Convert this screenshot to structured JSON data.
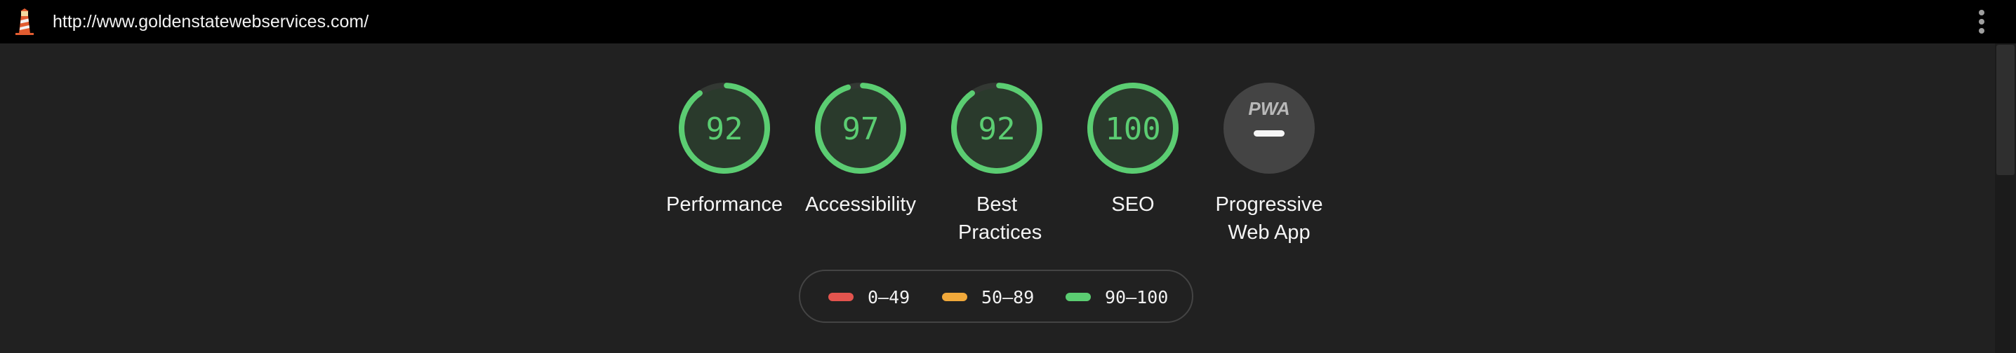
{
  "header": {
    "url": "http://www.goldenstatewebservices.com/",
    "logo_icon": "lighthouse-icon",
    "menu_icon": "vertical-dots-icon"
  },
  "gauges": [
    {
      "score": "92",
      "label": "Performance",
      "color": "#5bcd72",
      "fraction": 0.92
    },
    {
      "score": "97",
      "label": "Accessibility",
      "color": "#5bcd72",
      "fraction": 0.97
    },
    {
      "score": "92",
      "label": "Best Practices",
      "color": "#5bcd72",
      "fraction": 0.92
    },
    {
      "score": "100",
      "label": "SEO",
      "color": "#5bcd72",
      "fraction": 1.0
    }
  ],
  "pwa": {
    "badge_text": "PWA",
    "label": "Progressive Web App",
    "icon": "pwa-dash-icon"
  },
  "legend": [
    {
      "range": "0–49",
      "color": "#e3544e"
    },
    {
      "range": "50–89",
      "color": "#f0a83a"
    },
    {
      "range": "90–100",
      "color": "#5bcd72"
    }
  ],
  "colors": {
    "background": "#212121",
    "topbar": "#000000",
    "gauge_fill": "#2a3a2c",
    "gauge_track": "#333833",
    "pwa_circle": "#444444"
  }
}
